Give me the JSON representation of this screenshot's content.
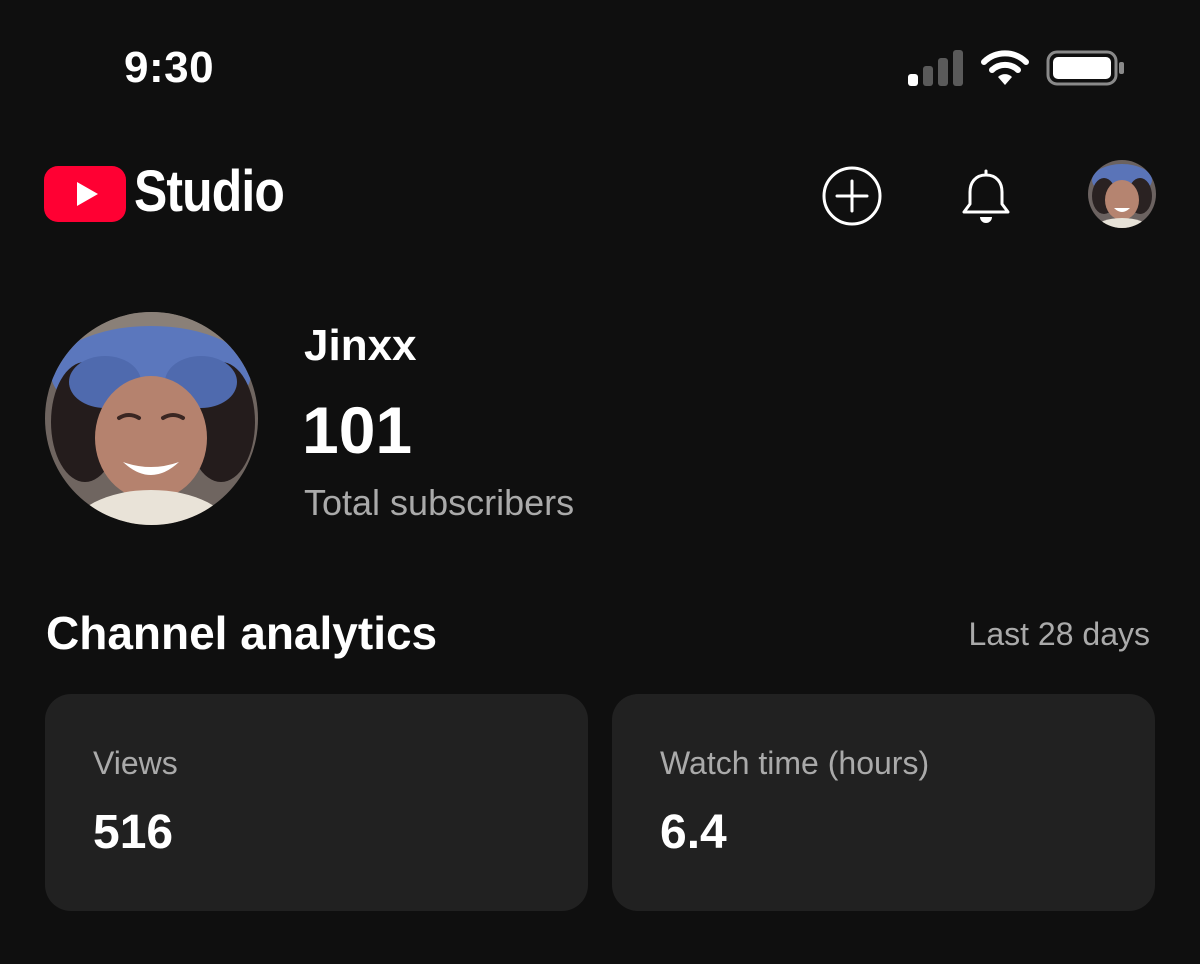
{
  "status_bar": {
    "time": "9:30",
    "icons": [
      "cellular-signal-icon",
      "wifi-icon",
      "battery-icon"
    ]
  },
  "header": {
    "logo_text": "Studio",
    "logo_icon": "youtube-play-icon",
    "brand_color": "#ff0033",
    "actions": [
      "create-plus-icon",
      "notifications-bell-icon",
      "account-avatar"
    ]
  },
  "channel": {
    "name": "Jinxx",
    "subscriber_count": "101",
    "subscriber_label": "Total subscribers"
  },
  "analytics": {
    "title": "Channel analytics",
    "period": "Last 28 days",
    "cards": [
      {
        "label": "Views",
        "value": "516"
      },
      {
        "label": "Watch time (hours)",
        "value": "6.4"
      }
    ]
  },
  "colors": {
    "background": "#0f0f0f",
    "card_background": "#212121",
    "primary_text": "#ffffff",
    "secondary_text": "#aaaaaa"
  }
}
